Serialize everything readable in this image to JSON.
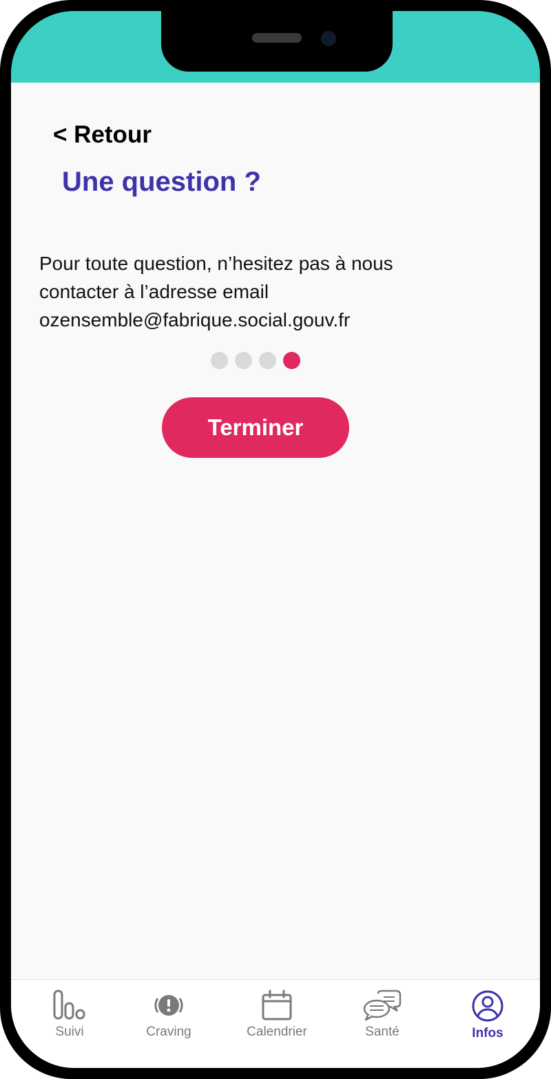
{
  "colors": {
    "status_band": "#3ccfc4",
    "title": "#3e33a8",
    "accent": "#e0295e",
    "tab_inactive": "#7a7a7a",
    "tab_active": "#3e33a8"
  },
  "header": {
    "back_label": "< Retour",
    "title": "Une question ?"
  },
  "content": {
    "line1": "Pour toute question, n’hesitez pas à nous",
    "line2": "contacter à l’adresse email",
    "line3": "ozensemble@fabrique.social.gouv.fr"
  },
  "pagination": {
    "total": 4,
    "current": 4
  },
  "actions": {
    "finish_label": "Terminer"
  },
  "tabbar": {
    "items": [
      {
        "label": "Suivi",
        "icon": "bar-chart-icon",
        "active": false
      },
      {
        "label": "Craving",
        "icon": "alert-circle-icon",
        "active": false
      },
      {
        "label": "Calendrier",
        "icon": "calendar-icon",
        "active": false
      },
      {
        "label": "Santé",
        "icon": "chat-bubbles-icon",
        "active": false
      },
      {
        "label": "Infos",
        "icon": "user-circle-icon",
        "active": true
      }
    ]
  }
}
